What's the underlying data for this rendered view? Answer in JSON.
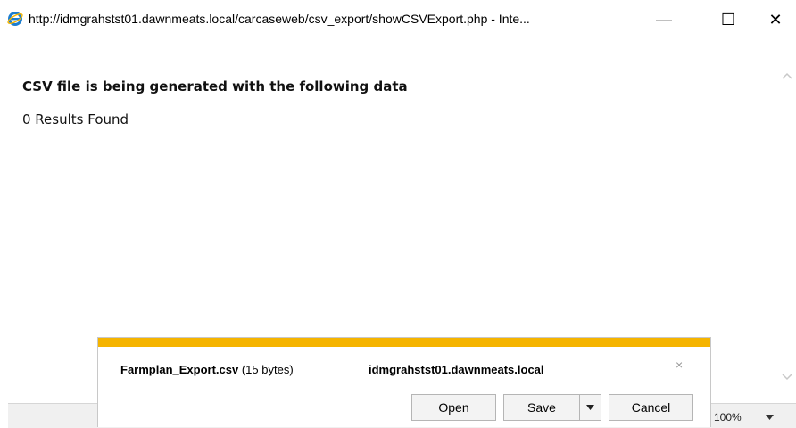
{
  "window": {
    "title": "http://idmgrahstst01.dawnmeats.local/carcaseweb/csv_export/showCSVExport.php - Inte...",
    "minimize_label": "—",
    "maximize_label": "☐",
    "close_label": "✕"
  },
  "page": {
    "heading": "CSV file is being generated with the following data",
    "results": "0 Results Found"
  },
  "status": {
    "zoom": "100%"
  },
  "download": {
    "file_name": "Farmplan_Export.csv",
    "file_size": "(15 bytes)",
    "host": "idmgrahstst01.dawnmeats.local",
    "open_label": "Open",
    "save_label": "Save",
    "cancel_label": "Cancel",
    "close_label": "×",
    "accent_color": "#f5b400"
  },
  "icons": {
    "browser": "ie-icon",
    "dropdown": "chevron-down-icon"
  }
}
